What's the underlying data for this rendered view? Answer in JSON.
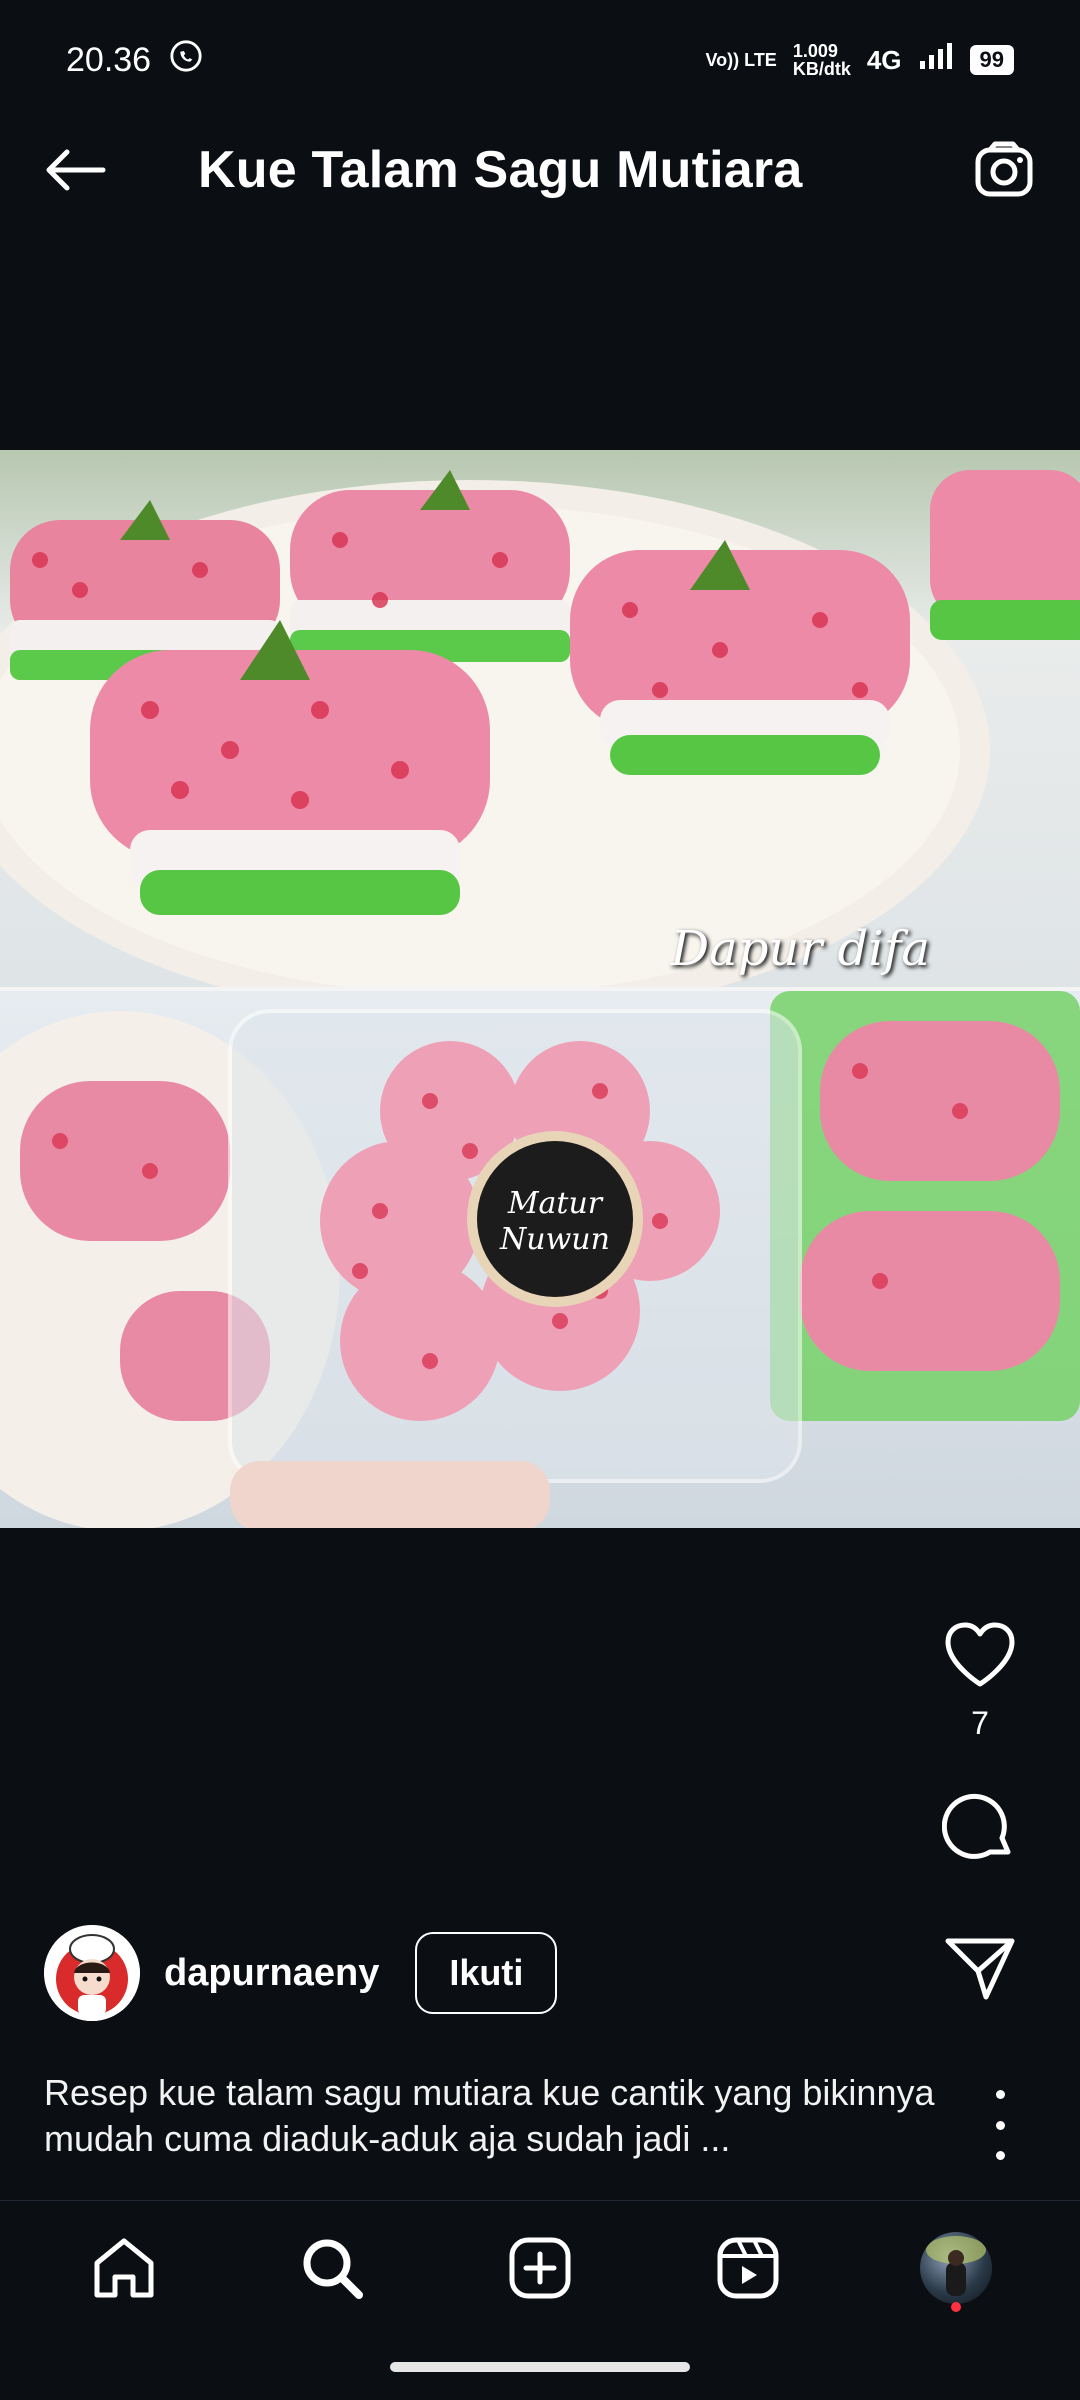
{
  "status_bar": {
    "time": "20.36",
    "volte": "Vo)) LTE",
    "speed_value": "1.009",
    "speed_unit": "KB/dtk",
    "network": "4G",
    "battery": "99"
  },
  "header": {
    "title": "Kue Talam Sagu Mutiara"
  },
  "media": {
    "watermark": "Dapur difa"
  },
  "actions": {
    "like_count": "7"
  },
  "post": {
    "username": "dapurnaeny",
    "follow_label": "Ikuti",
    "caption": "Resep kue talam sagu mutiara kue cantik yang bikinnya mudah cuma diaduk-aduk aja sudah jadi ..."
  },
  "icons": {
    "back": "arrow-left-icon",
    "camera": "camera-icon",
    "like": "heart-icon",
    "comment": "comment-icon",
    "share": "send-icon",
    "more": "more-vertical-icon",
    "home": "home-icon",
    "search": "search-icon",
    "create": "plus-square-icon",
    "reels": "reels-icon"
  },
  "colors": {
    "background": "#0b0f14",
    "accent_notification": "#ff3040"
  }
}
